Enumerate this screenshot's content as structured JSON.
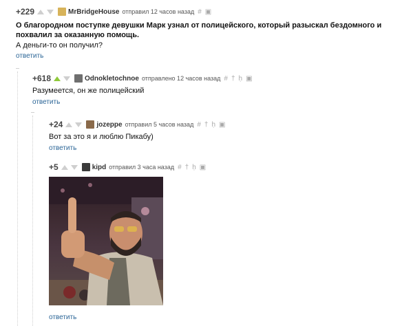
{
  "comments": [
    {
      "rating": "+229",
      "author": "MrBridgeHouse",
      "meta": "отправил 12 часов назад",
      "title": "О благородном поступке девушки Марк узнал от полицейского, который разыскал бездомного и похвалил за оказанную помощь.",
      "text": "А деньги-то он получил?",
      "reply": "ответить"
    },
    {
      "rating": "+618",
      "author": "Odnokletochnoe",
      "meta": "отправлено 12 часов назад",
      "text": "Разумеется, он же полицейский",
      "reply": "ответить"
    },
    {
      "rating": "+24",
      "author": "jozeppe",
      "meta": "отправил 5 часов назад",
      "text": "Вот за это я и люблю Пикабу)",
      "reply": "ответить"
    },
    {
      "rating": "+5",
      "author": "kipd",
      "meta": "отправил 3 часа назад",
      "reply": "ответить"
    }
  ],
  "icons": {
    "hash": "#",
    "plus": "+",
    "pin": "†",
    "flag": "ḥ",
    "save": "▣"
  },
  "colors": {
    "upvote_active": "#8fc93a",
    "link": "#2a6496"
  }
}
